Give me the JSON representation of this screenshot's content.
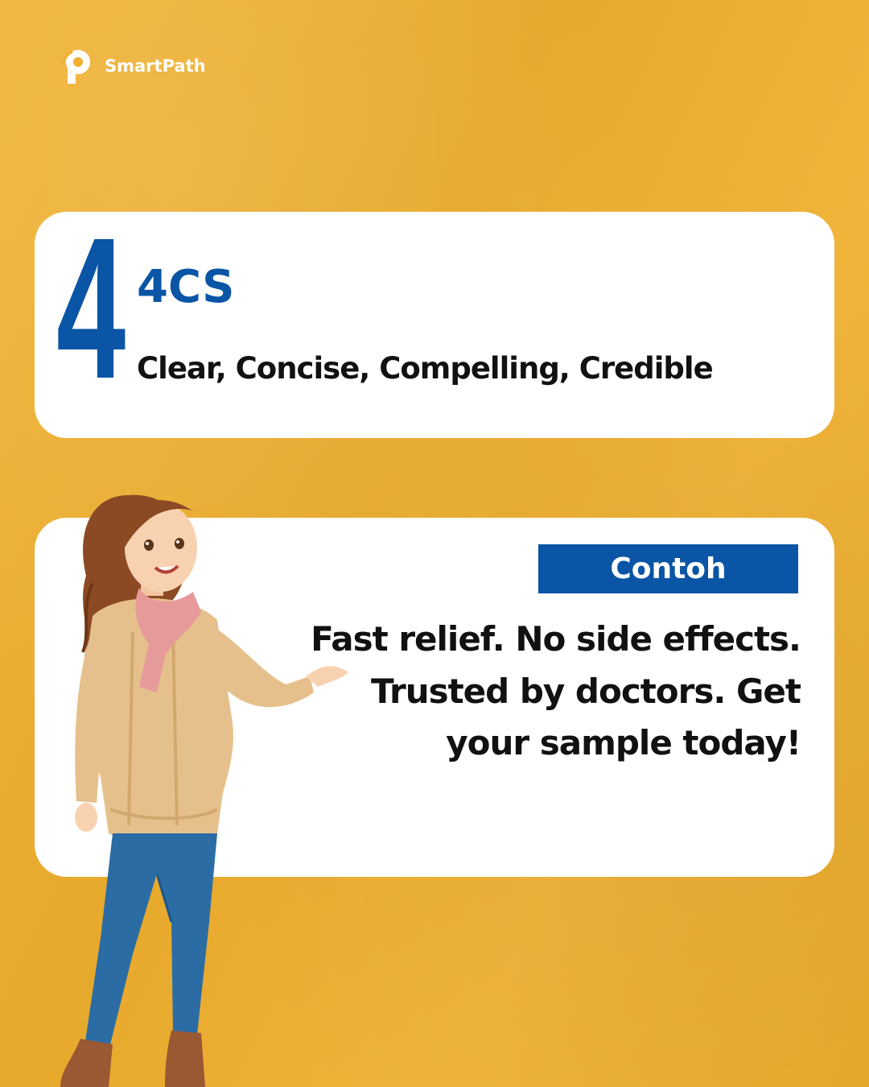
{
  "brand": {
    "name": "SmartPath",
    "logo_icon": "path-p-logo-icon"
  },
  "point": {
    "number": "4",
    "title": "4CS",
    "subtitle": "Clear, Concise, Compelling, Credible"
  },
  "example": {
    "badge_label": "Contoh",
    "text": "Fast relief. No side effects. Trusted by doctors. Get your sample today!"
  },
  "colors": {
    "background": "#F0B02E",
    "accent_blue": "#0A55A5",
    "card": "#FFFFFF",
    "text": "#111111"
  }
}
